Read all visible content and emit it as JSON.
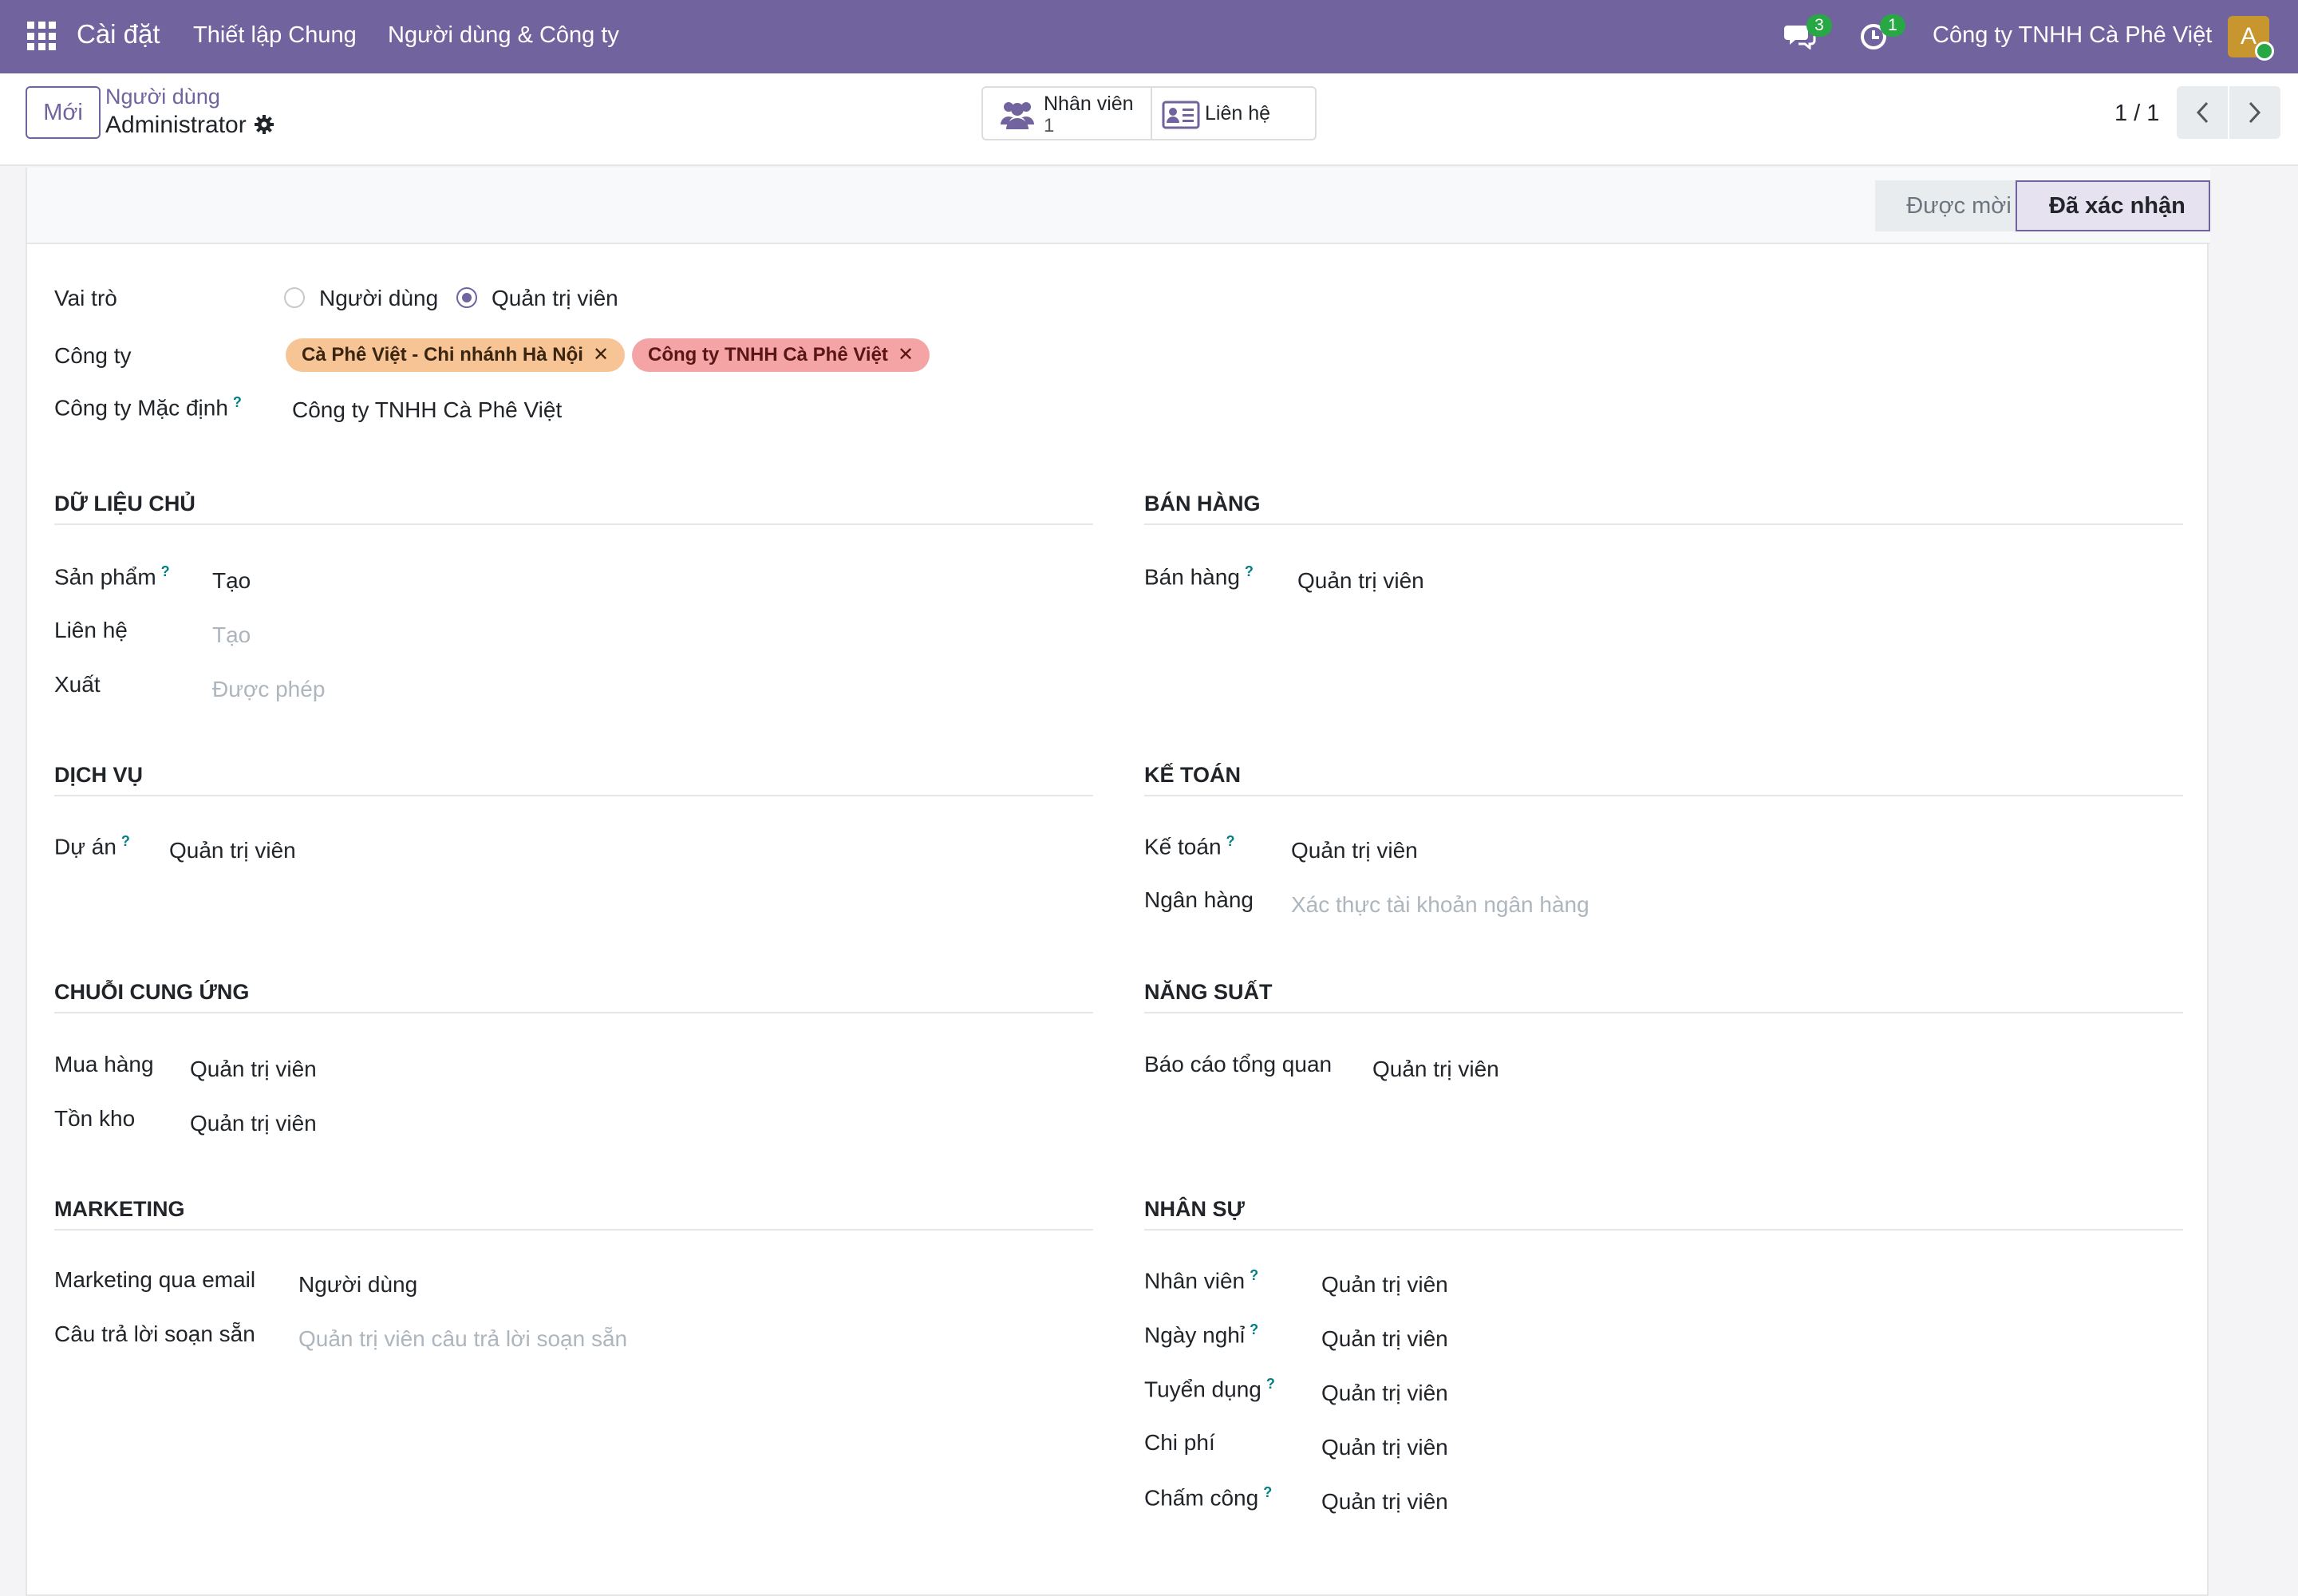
{
  "navbar": {
    "app_name": "Cài đặt",
    "menu": [
      "Thiết lập Chung",
      "Người dùng & Công ty"
    ],
    "chat_count": "3",
    "activity_count": "1",
    "company": "Công ty TNHH Cà Phê Việt",
    "avatar_letter": "A"
  },
  "control": {
    "new_label": "Mới",
    "breadcrumb_parent": "Người dùng",
    "breadcrumb_current": "Administrator",
    "smart_employees_label": "Nhân viên",
    "smart_employees_count": "1",
    "smart_contact_label": "Liên hệ",
    "pager": "1 / 1"
  },
  "status": {
    "invited": "Được mời",
    "confirmed": "Đã xác nhận"
  },
  "fields": {
    "role_label": "Vai trò",
    "role_user": "Người dùng",
    "role_admin": "Quản trị viên",
    "companies_label": "Công ty",
    "company_tag_1": "Cà Phê Việt - Chi nhánh Hà Nội",
    "company_tag_2": "Công ty TNHH Cà Phê Việt",
    "default_company_label": "Công ty Mặc định",
    "default_company_value": "Công ty TNHH Cà Phê Việt"
  },
  "sections": {
    "master_data": {
      "title": "Dữ liệu chủ",
      "rows": [
        {
          "label": "Sản phẩm",
          "value": "Tạo"
        },
        {
          "label": "Liên hệ",
          "placeholder": "Tạo"
        },
        {
          "label": "Xuất",
          "placeholder": "Được phép"
        }
      ]
    },
    "sales": {
      "title": "Bán hàng",
      "rows": [
        {
          "label": "Bán hàng",
          "value": "Quản trị viên"
        }
      ]
    },
    "services": {
      "title": "Dịch vụ",
      "rows": [
        {
          "label": "Dự án",
          "value": "Quản trị viên"
        }
      ]
    },
    "accounting": {
      "title": "Kế toán",
      "rows": [
        {
          "label": "Kế toán",
          "value": "Quản trị viên"
        },
        {
          "label": "Ngân hàng",
          "placeholder": "Xác thực tài khoản ngân hàng"
        }
      ]
    },
    "supply_chain": {
      "title": "Chuỗi cung ứng",
      "rows": [
        {
          "label": "Mua hàng",
          "value": "Quản trị viên"
        },
        {
          "label": "Tồn kho",
          "value": "Quản trị viên"
        }
      ]
    },
    "productivity": {
      "title": "Năng suất",
      "rows": [
        {
          "label": "Báo cáo tổng quan",
          "value": "Quản trị viên"
        }
      ]
    },
    "marketing": {
      "title": "Marketing",
      "rows": [
        {
          "label": "Marketing qua email",
          "value": "Người dùng"
        },
        {
          "label": "Câu trả lời soạn sẵn",
          "placeholder": "Quản trị viên câu trả lời soạn sẵn"
        }
      ]
    },
    "hr": {
      "title": "Nhân sự",
      "rows": [
        {
          "label": "Nhân viên",
          "value": "Quản trị viên"
        },
        {
          "label": "Ngày nghỉ",
          "value": "Quản trị viên"
        },
        {
          "label": "Tuyển dụng",
          "value": "Quản trị viên"
        },
        {
          "label": "Chi phí",
          "value": "Quản trị viên"
        },
        {
          "label": "Chấm công",
          "value": "Quản trị viên"
        }
      ]
    }
  },
  "colors": {
    "brand": "#71639e",
    "badge": "#28a745",
    "help": "#017e84"
  }
}
